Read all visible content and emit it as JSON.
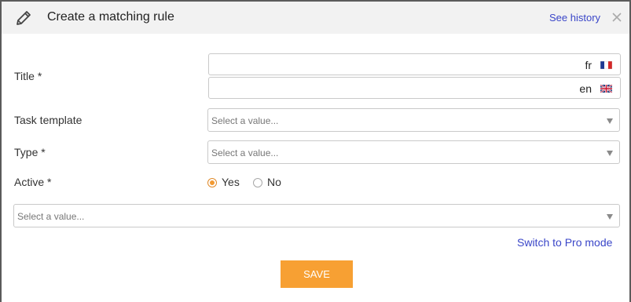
{
  "header": {
    "title": "Create a matching rule",
    "history_link": "See history",
    "icon": "pencil-icon",
    "close_icon": "close-icon"
  },
  "form": {
    "title_field": {
      "label": "Title *",
      "languages": [
        {
          "code": "fr",
          "value": "",
          "flag": "france-flag-icon"
        },
        {
          "code": "en",
          "value": "",
          "flag": "uk-flag-icon"
        }
      ]
    },
    "task_template": {
      "label": "Task template",
      "placeholder": "Select a value..."
    },
    "type": {
      "label": "Type *",
      "placeholder": "Select a value..."
    },
    "active": {
      "label": "Active *",
      "options": [
        {
          "label": "Yes",
          "checked": true
        },
        {
          "label": "No",
          "checked": false
        }
      ]
    },
    "extra_select": {
      "placeholder": "Select a value..."
    }
  },
  "switch_mode_link": "Switch to Pro mode",
  "save_button": "SAVE",
  "colors": {
    "accent": "#f7a033",
    "link": "#3a46c8",
    "header_bg": "#f2f2f2"
  }
}
